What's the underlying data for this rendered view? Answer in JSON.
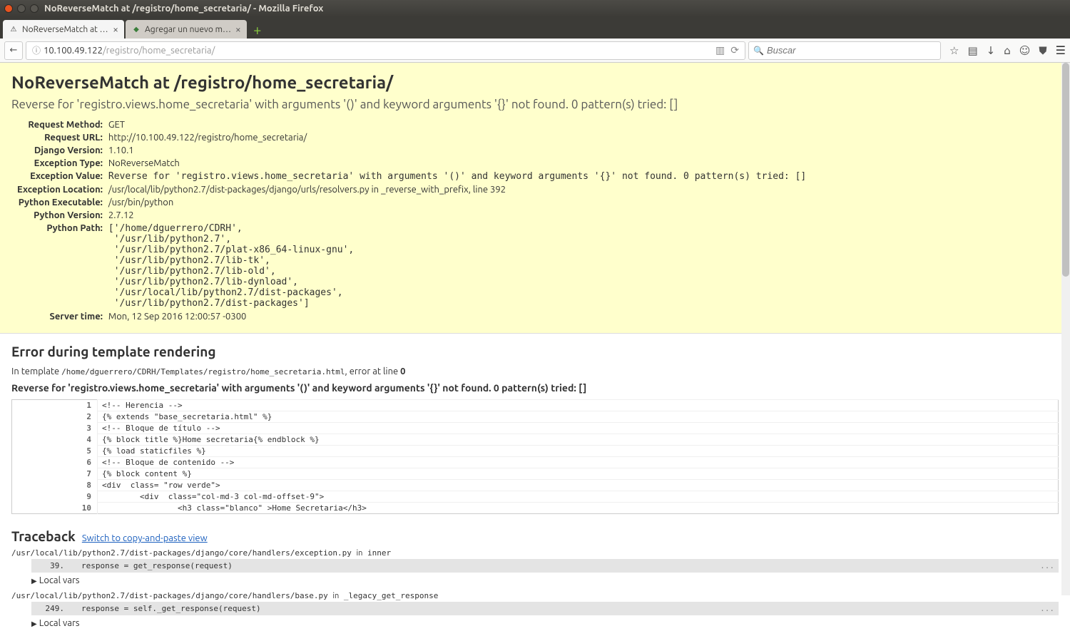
{
  "window": {
    "title": "NoReverseMatch at /registro/home_secretaria/ - Mozilla Firefox"
  },
  "tabs": [
    {
      "title": "NoReverseMatch at /re…",
      "active": true
    },
    {
      "title": "Agregar un nuevo m…",
      "active": false
    }
  ],
  "url": {
    "host": "10.100.49.122",
    "path": "/registro/home_secretaria/"
  },
  "search": {
    "placeholder": "Buscar"
  },
  "error": {
    "heading": "NoReverseMatch at /registro/home_secretaria/",
    "sub": "Reverse for 'registro.views.home_secretaria' with arguments '()' and keyword arguments '{}' not found. 0 pattern(s) tried: []"
  },
  "meta": {
    "request_method": {
      "label": "Request Method:",
      "value": "GET"
    },
    "request_url": {
      "label": "Request URL:",
      "value": "http://10.100.49.122/registro/home_secretaria/"
    },
    "django_version": {
      "label": "Django Version:",
      "value": "1.10.1"
    },
    "exception_type": {
      "label": "Exception Type:",
      "value": "NoReverseMatch"
    },
    "exception_value": {
      "label": "Exception Value:",
      "value": "Reverse for 'registro.views.home_secretaria' with arguments '()' and keyword arguments '{}' not found. 0 pattern(s) tried: []"
    },
    "exception_location": {
      "label": "Exception Location:",
      "value": "/usr/local/lib/python2.7/dist-packages/django/urls/resolvers.py in _reverse_with_prefix, line 392"
    },
    "python_executable": {
      "label": "Python Executable:",
      "value": "/usr/bin/python"
    },
    "python_version": {
      "label": "Python Version:",
      "value": "2.7.12"
    },
    "python_path": {
      "label": "Python Path:",
      "value": "['/home/dguerrero/CDRH',\n '/usr/lib/python2.7',\n '/usr/lib/python2.7/plat-x86_64-linux-gnu',\n '/usr/lib/python2.7/lib-tk',\n '/usr/lib/python2.7/lib-old',\n '/usr/lib/python2.7/lib-dynload',\n '/usr/local/lib/python2.7/dist-packages',\n '/usr/lib/python2.7/dist-packages']"
    },
    "server_time": {
      "label": "Server time:",
      "value": "Mon, 12 Sep 2016 12:00:57 -0300"
    }
  },
  "template_error": {
    "heading": "Error during template rendering",
    "prefix": "In template ",
    "path": "/home/dguerrero/CDRH/Templates/registro/home_secretaria.html",
    "suffix": ", error at line ",
    "line": "0",
    "reverse_msg": "Reverse for 'registro.views.home_secretaria' with arguments '()' and keyword arguments '{}' not found. 0 pattern(s) tried: []"
  },
  "source_lines": [
    {
      "n": "1",
      "code": "<!-- Herencia -->"
    },
    {
      "n": "2",
      "code": "{% extends \"base_secretaria.html\" %}"
    },
    {
      "n": "3",
      "code": "<!-- Bloque de título -->"
    },
    {
      "n": "4",
      "code": "{% block title %}Home secretaria{% endblock %}"
    },
    {
      "n": "5",
      "code": "{% load staticfiles %}"
    },
    {
      "n": "6",
      "code": "<!-- Bloque de contenido -->"
    },
    {
      "n": "7",
      "code": "{% block content %}"
    },
    {
      "n": "8",
      "code": "<div  class= \"row verde\">"
    },
    {
      "n": "9",
      "code": "        <div  class=\"col-md-3 col-md-offset-9\">"
    },
    {
      "n": "10",
      "code": "                <h3 class=\"blanco\" >Home Secretaria</h3>"
    }
  ],
  "traceback": {
    "heading": "Traceback",
    "switch": "Switch to copy-and-paste view",
    "frames": [
      {
        "path": "/usr/local/lib/python2.7/dist-packages/django/core/handlers/exception.py",
        "in": "inner",
        "ln": "39.",
        "code": "            response = get_response(request)"
      },
      {
        "path": "/usr/local/lib/python2.7/dist-packages/django/core/handlers/base.py",
        "in": "_legacy_get_response",
        "ln": "249.",
        "code": "            response = self._get_response(request)"
      }
    ],
    "local_vars": "Local vars"
  }
}
